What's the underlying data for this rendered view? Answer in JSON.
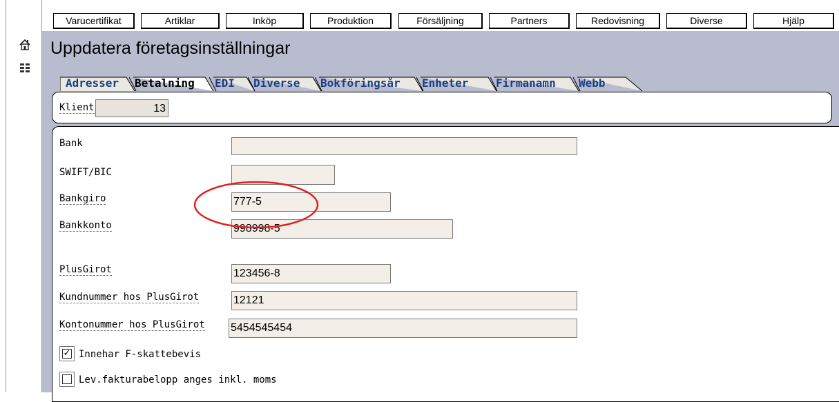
{
  "menu": {
    "items": [
      "Varucertifikat",
      "Artiklar",
      "Inköp",
      "Produktion",
      "Försäljning",
      "Partners",
      "Redovisning",
      "Diverse",
      "Hjälp"
    ]
  },
  "rail": {
    "icons": [
      "home-icon",
      "list-icon"
    ]
  },
  "page": {
    "title": "Uppdatera företagsinställningar"
  },
  "tabs": [
    "Adresser",
    "Betalning",
    "EDI",
    "Diverse",
    "Bokföringsår",
    "Enheter",
    "Firmanamn",
    "Webb"
  ],
  "active_tab": "Betalning",
  "client": {
    "label": "Klient",
    "value": "13"
  },
  "form": {
    "bank": {
      "label": "Bank",
      "value": ""
    },
    "swift": {
      "label": "SWIFT/BIC",
      "value": ""
    },
    "bankgiro": {
      "label": "Bankgiro",
      "value": "777-5"
    },
    "bankkonto": {
      "label": "Bankkonto",
      "value": "998998-5"
    },
    "plusgirot": {
      "label": "PlusGirot",
      "value": "123456-8"
    },
    "kundnummer": {
      "label": "Kundnummer hos PlusGirot",
      "value": "12121"
    },
    "kontonummer": {
      "label": "Kontonummer hos PlusGirot",
      "value": "5454545454"
    },
    "fskatt": {
      "label": "Innehar F-skattebevis",
      "checked": true
    },
    "levfaktura": {
      "label": "Lev.fakturabelopp anges inkl. moms",
      "checked": false
    }
  },
  "colors": {
    "background": "#b9bccf",
    "tab_text": "#1b3f80",
    "annotation": "#e02020"
  }
}
